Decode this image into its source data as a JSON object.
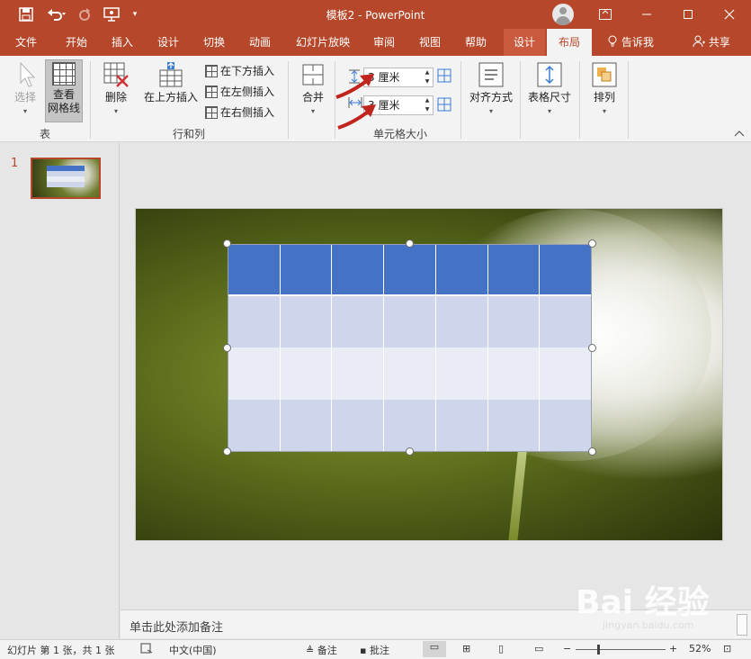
{
  "window": {
    "title": "模板2  -  PowerPoint",
    "quick_access": [
      "save-icon",
      "undo-icon",
      "redo-icon",
      "present-icon",
      "customize-icon"
    ],
    "controls": [
      "ribbon-display-icon",
      "minimize-icon",
      "maximize-icon",
      "close-icon"
    ]
  },
  "tabs": {
    "items": [
      "文件",
      "开始",
      "插入",
      "设计",
      "切换",
      "动画",
      "幻灯片放映",
      "审阅",
      "视图",
      "帮助",
      "设计",
      "布局"
    ],
    "active": "布局",
    "tell_me": "告诉我",
    "share": "共享"
  },
  "ribbon": {
    "select_label": "选择",
    "gridlines_label": "查看\n网格线",
    "group_table": "表",
    "delete_label": "删除",
    "insert_above_label": "在上方插入",
    "insert_below_label": "在下方插入",
    "insert_left_label": "在左侧插入",
    "insert_right_label": "在右侧插入",
    "group_rows_cols": "行和列",
    "merge_label": "合并",
    "height_value": "3 厘米",
    "width_value": "3 厘米",
    "group_cell_size": "单元格大小",
    "align_label": "对齐方式",
    "table_size_label": "表格尺寸",
    "arrange_label": "排列"
  },
  "slides_pane": {
    "slide_number": "1"
  },
  "slide": {
    "table": {
      "columns": 7,
      "rows": [
        "header",
        "band1",
        "band2",
        "band3"
      ],
      "header_color": "#4472c4",
      "band_colors": [
        "#cfd5ea",
        "#e9ebf5",
        "#cfd5ea"
      ]
    }
  },
  "notes_placeholder": "单击此处添加备注",
  "statusbar": {
    "slide_info": "幻灯片 第 1 张，共 1 张",
    "language": "中文(中国)",
    "notes_label": "备注",
    "comments_label": "批注",
    "zoom": "52%"
  },
  "watermark": {
    "text": "Bai 经验",
    "url": "jingyan.baidu.com"
  },
  "colors": {
    "accent": "#b7472a",
    "ribbon_bg": "#f3f3f3"
  }
}
